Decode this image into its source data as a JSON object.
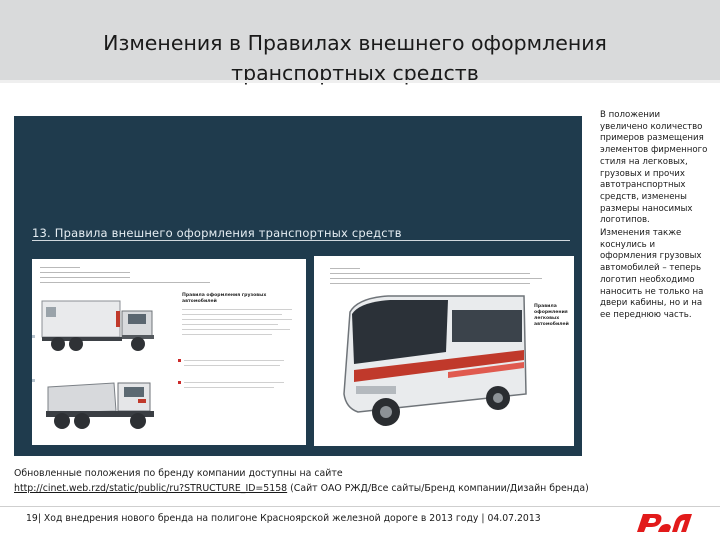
{
  "slide": {
    "title_line1": "Изменения в Правилах внешнего оформления",
    "title_line2": "транспортных средств"
  },
  "panel": {
    "doc_title": "13. Правила внешнего оформления транспортных средств",
    "left_page_caption": "Правила оформления грузовых автомобилей",
    "right_page_caption": "Правила оформления легковых автомобилей"
  },
  "side_text": {
    "paragraph1": "В положении увеличено количество примеров размещения элементов фирменного стиля на легковых, грузовых и прочих автотранспортных средств, изменены размеры наносимых логотипов.",
    "paragraph2": "Изменения также коснулись и оформления грузовых автомобилей – теперь логотип необходимо наносить не только на двери кабины, но и на ее переднюю часть."
  },
  "bottom_note": {
    "lead": "Обновленные положения по бренду компании доступны на сайте",
    "link": "http://cinet.web.rzd/static/public/ru?STRUCTURE_ID=5158",
    "path": "(Сайт ОАО РЖД/Все сайты/Бренд компании/Дизайн бренда)"
  },
  "footer": {
    "text": "19| Ход внедрения нового бренда на полигоне Красноярской железной дороге в 2013 году | 04.07.2013"
  },
  "logo": {
    "icon": "rzd-logo-icon",
    "color": "#e21a1a"
  },
  "colors": {
    "panel": "#1f3b4d",
    "header": "#d9dadb",
    "accent": "#e21a1a"
  }
}
